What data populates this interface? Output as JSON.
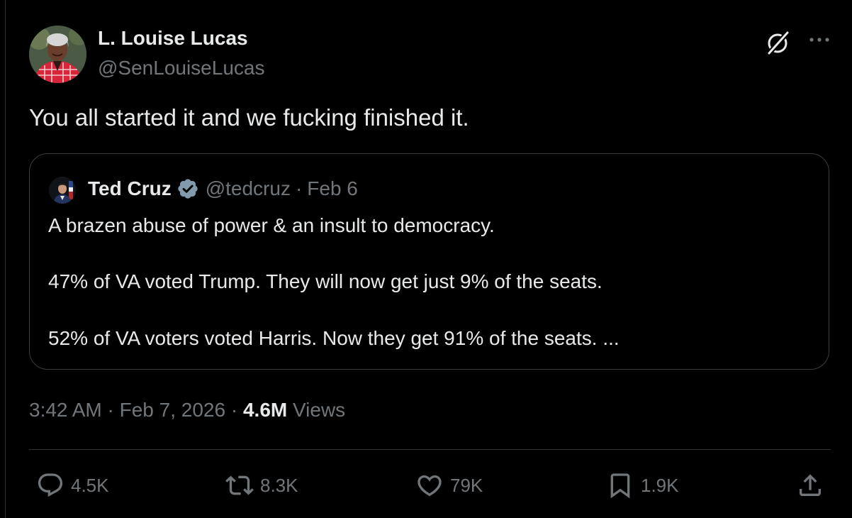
{
  "tweet": {
    "author": {
      "name": "L. Louise Lucas",
      "handle": "@SenLouiseLucas"
    },
    "text": "You all started it and we fucking finished it.",
    "quoted": {
      "author_name": "Ted Cruz",
      "handle": "@tedcruz",
      "separator": "·",
      "date": "Feb 6",
      "lines": [
        "A brazen abuse of power & an insult to democracy.",
        "47% of VA voted Trump. They will now get just 9% of the seats.",
        "52% of VA voters voted Harris. Now they get 91% of the seats. ..."
      ]
    },
    "meta": {
      "time": "3:42 AM",
      "date": "Feb 7, 2026",
      "separator": "·",
      "views_count": "4.6M",
      "views_label": "Views"
    },
    "actions": {
      "replies": "4.5K",
      "reposts": "8.3K",
      "likes": "79K",
      "bookmarks": "1.9K"
    }
  },
  "icons": {
    "header_right": [
      "grok-icon",
      "more-icon"
    ],
    "actions": [
      "reply-icon",
      "repost-icon",
      "like-icon",
      "bookmark-icon",
      "share-icon"
    ],
    "verified": "verified-badge-icon"
  },
  "colors": {
    "background": "#000000",
    "text_primary": "#e7e9ea",
    "text_secondary": "#71767b",
    "border": "#2f3336",
    "verified_badge": "#829aab"
  }
}
